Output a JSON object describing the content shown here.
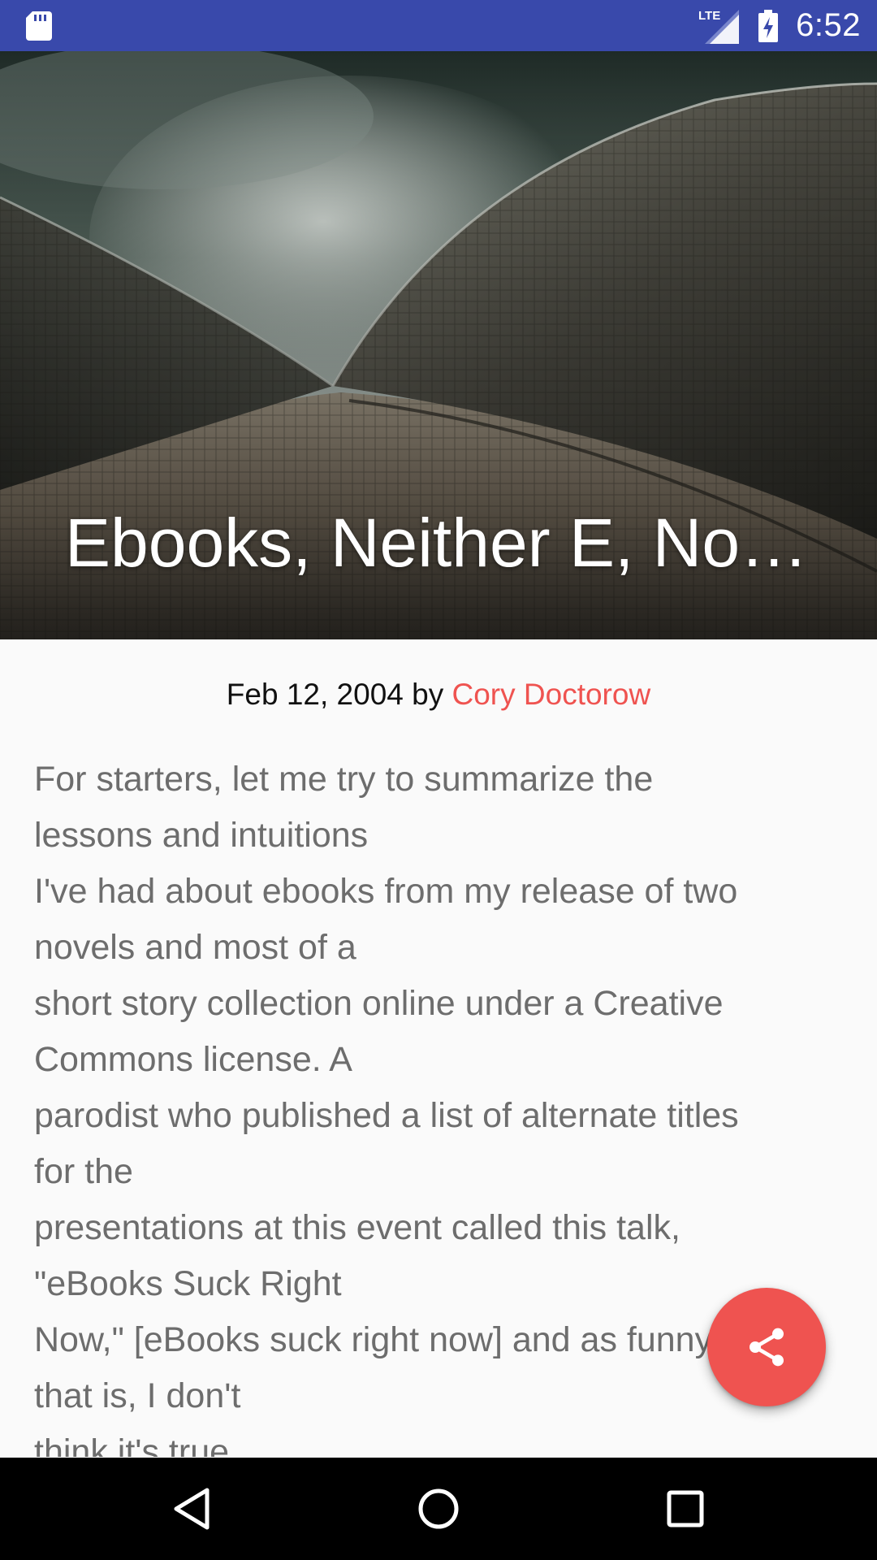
{
  "status_bar": {
    "time": "6:52",
    "network": "LTE",
    "icons": [
      "sd-card-icon",
      "lte-signal-icon",
      "battery-charging-icon"
    ]
  },
  "header": {
    "title": "Ebooks, Neither E, Nor Books"
  },
  "meta": {
    "date_by": "Feb 12, 2004 by ",
    "author": "Cory Doctorow"
  },
  "article": {
    "lines": [
      "For starters, let me try to summarize the",
      "lessons and intuitions",
      "I've had about ebooks from my release of two",
      "novels and most of a",
      "short story collection online under a Creative",
      "Commons license. A",
      "parodist who published a list of alternate titles",
      "for the",
      "presentations at this event called this talk,",
      "\"eBooks Suck Right",
      "Now,\" [eBooks suck right now] and as funny as",
      "that is, I don't",
      "think it's true."
    ]
  },
  "fab": {
    "icon": "share-icon"
  },
  "colors": {
    "status_bar": "#3949ab",
    "accent": "#ef5350",
    "body_text": "#6d6d6d",
    "background": "#fafafa"
  }
}
